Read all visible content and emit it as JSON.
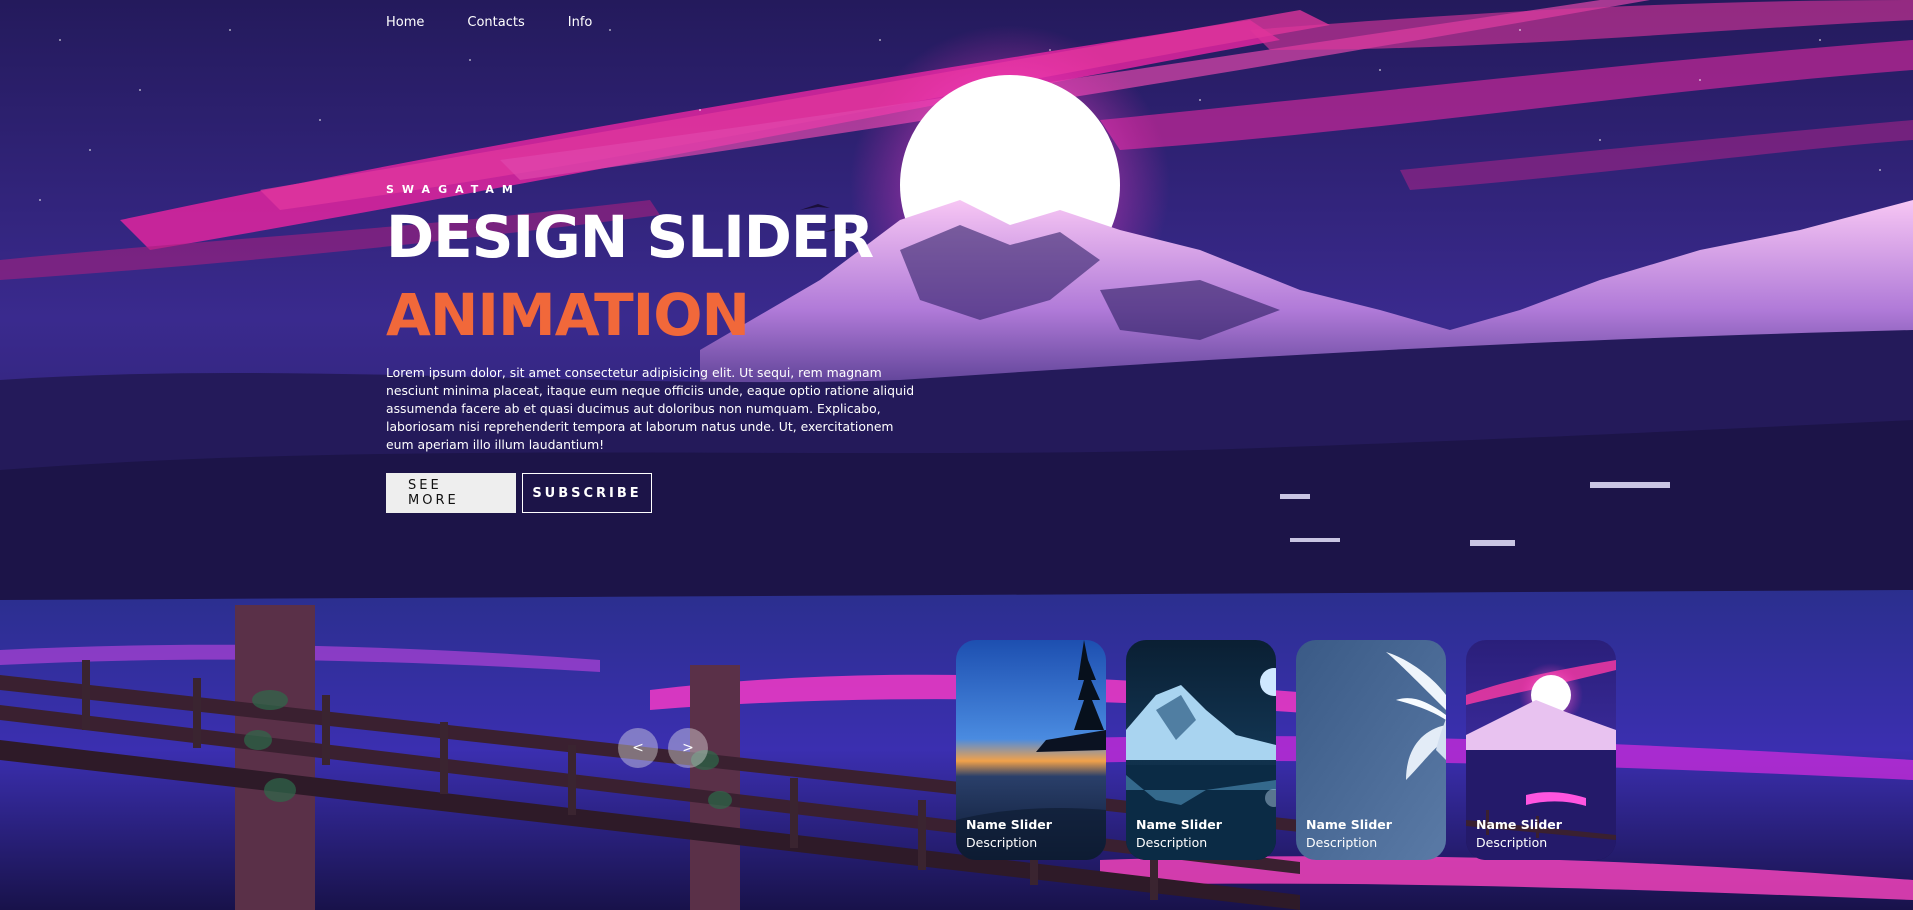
{
  "nav": {
    "items": [
      {
        "label": "Home"
      },
      {
        "label": "Contacts"
      },
      {
        "label": "Info"
      }
    ]
  },
  "hero": {
    "author": "SWAGATAM",
    "title": "DESIGN SLIDER",
    "topic": "ANIMATION",
    "description": "Lorem ipsum dolor, sit amet consectetur adipisicing elit. Ut sequi, rem magnam nesciunt minima placeat, itaque eum neque officiis unde, eaque optio ratione aliquid assumenda facere ab et quasi ducimus aut doloribus non numquam. Explicabo, laboriosam nisi reprehenderit tempora at laborum natus unde. Ut, exercitationem eum aperiam illo illum laudantium!",
    "see_more_label": "SEE MORE",
    "subscribe_label": "SUBSCRIBE"
  },
  "thumbnails": [
    {
      "name": "Name Slider",
      "description": "Description",
      "scene": "sunset-lake-pine"
    },
    {
      "name": "Name Slider",
      "description": "Description",
      "scene": "moonlit-mountain-lake"
    },
    {
      "name": "Name Slider",
      "description": "Description",
      "scene": "white-flower"
    },
    {
      "name": "Name Slider",
      "description": "Description",
      "scene": "pink-mountain-sun"
    }
  ],
  "arrows": {
    "prev_label": "<",
    "next_label": ">"
  },
  "colors": {
    "accent": "#f1683a",
    "sky": "#2a1a6e",
    "sun": "#ffffff",
    "magenta": "#ff2bb0"
  }
}
